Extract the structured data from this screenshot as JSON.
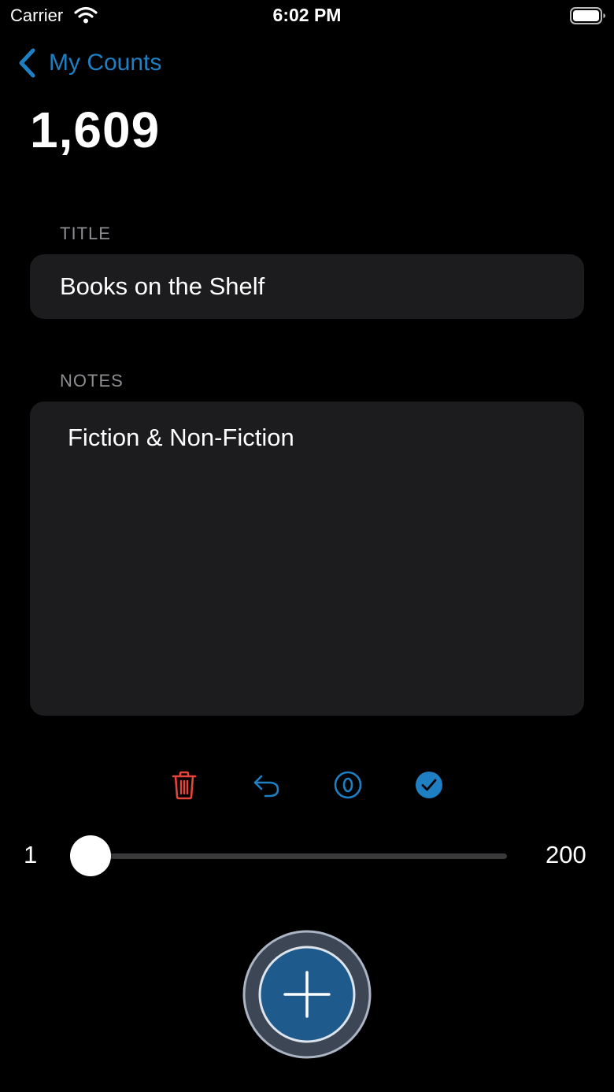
{
  "status_bar": {
    "carrier": "Carrier",
    "time": "6:02 PM"
  },
  "nav": {
    "back_label": "My Counts",
    "back_icon": "chevron-left-icon"
  },
  "counter": {
    "value": "1,609"
  },
  "title_section": {
    "label": "TITLE",
    "value": "Books on the Shelf"
  },
  "notes_section": {
    "label": "NOTES",
    "value": "Fiction & Non-Fiction"
  },
  "actions": [
    {
      "name": "delete",
      "icon": "trash-icon",
      "color": "#e5443a"
    },
    {
      "name": "undo",
      "icon": "undo-arrow-icon",
      "color": "#1e7fc2"
    },
    {
      "name": "reset",
      "icon": "reset-zero-icon",
      "color": "#1e7fc2"
    },
    {
      "name": "done",
      "icon": "checkmark-circle-icon",
      "color": "#1e7fc2"
    }
  ],
  "step_slider": {
    "min_label": "1",
    "max_label": "200",
    "min": 1,
    "max": 200,
    "value": 1
  },
  "add_button": {
    "icon": "plus-icon"
  },
  "colors": {
    "background": "#000000",
    "field_background": "#1c1c1e",
    "accent": "#1e7fc2",
    "destructive": "#e5443a",
    "secondary_text": "#8e8e93",
    "add_button_fill": "#1e5a8c"
  }
}
